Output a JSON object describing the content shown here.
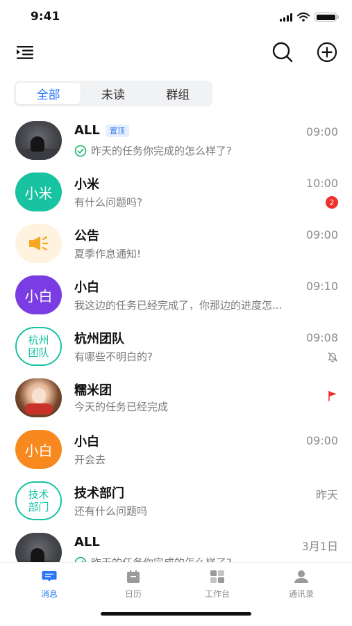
{
  "status_bar": {
    "time": "9:41"
  },
  "segment_tabs": [
    {
      "label": "全部",
      "active": true
    },
    {
      "label": "未读",
      "active": false
    },
    {
      "label": "群组",
      "active": false
    }
  ],
  "chats": [
    {
      "name": "ALL",
      "pin_label": "置顶",
      "time": "09:00",
      "preview": "昨天的任务你完成的怎么样了?",
      "avatar": "photo-night",
      "check": true
    },
    {
      "name": "小米",
      "time": "10:00",
      "preview": "有什么问题吗?",
      "avatar_text": "小米",
      "avatar_color": "#17c3a0",
      "badge": "2"
    },
    {
      "name": "公告",
      "time": "09:00",
      "preview": "夏季作息通知!",
      "avatar": "announcement-icon"
    },
    {
      "name": "小白",
      "time": "09:10",
      "preview": "我这边的任务已经完成了，你那边的进度怎...",
      "avatar_text": "小白",
      "avatar_color": "#7a3ce3"
    },
    {
      "name": "杭州团队",
      "time": "09:08",
      "preview": "有哪些不明白的?",
      "avatar_text": "杭州\n团队",
      "muted": true
    },
    {
      "name": "糯米团",
      "time": "",
      "preview": "今天的任务已经完成",
      "avatar": "photo-girl",
      "flag": true
    },
    {
      "name": "小白",
      "time": "09:00",
      "preview": "开会去",
      "avatar_text": "小白",
      "avatar_color": "#f7891e"
    },
    {
      "name": "技术部门",
      "time": "昨天",
      "preview": "还有什么问题吗",
      "avatar_text": "技术\n部门"
    },
    {
      "name": "ALL",
      "time": "3月1日",
      "preview": "昨天的任务你完成的怎么样了?",
      "avatar": "photo-night",
      "check": true
    }
  ],
  "tab_bar": [
    {
      "label": "消息",
      "icon": "message-icon",
      "active": true
    },
    {
      "label": "日历",
      "icon": "calendar-icon",
      "active": false
    },
    {
      "label": "工作台",
      "icon": "workbench-icon",
      "active": false
    },
    {
      "label": "通讯录",
      "icon": "contacts-icon",
      "active": false
    }
  ],
  "colors": {
    "accent": "#2a76f5",
    "teal": "#16c2a3",
    "badge": "#f2302b"
  }
}
